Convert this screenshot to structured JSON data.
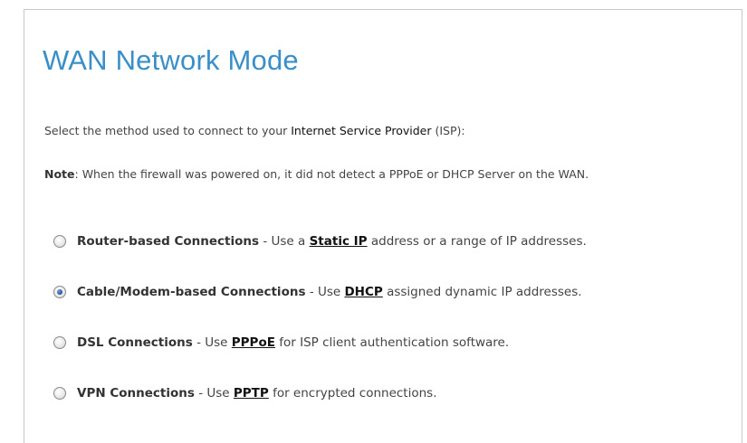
{
  "page": {
    "title": "WAN Network Mode",
    "intro": {
      "before": "Select the method used to connect to your ",
      "term": "Internet Service Provider",
      "after": " (ISP):"
    },
    "note": {
      "label": "Note",
      "text": ": When the firewall was powered on, it did not detect a PPPoE or DHCP Server on the WAN."
    }
  },
  "options": [
    {
      "title": "Router-based Connections",
      "before": " - Use a ",
      "link": "Static IP",
      "after": " address or a range of IP addresses.",
      "selected": false
    },
    {
      "title": "Cable/Modem-based Connections",
      "before": " - Use ",
      "link": "DHCP",
      "after": " assigned dynamic IP addresses.",
      "selected": true
    },
    {
      "title": "DSL Connections",
      "before": " - Use ",
      "link": "PPPoE",
      "after": " for ISP client authentication software.",
      "selected": false
    },
    {
      "title": "VPN Connections",
      "before": " - Use ",
      "link": "PPTP",
      "after": " for encrypted connections.",
      "selected": false
    }
  ],
  "colors": {
    "title": "#3a8fc9",
    "text": "#444444",
    "border": "#c8c8c8",
    "radio_selected": "#1d4f9c"
  }
}
